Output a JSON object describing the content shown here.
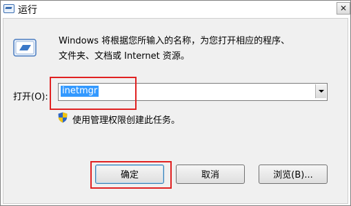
{
  "window": {
    "title": "运行",
    "close_glyph": "✕"
  },
  "description": {
    "line1": "Windows 将根据您所输入的名称，为您打开相应的程序、",
    "line2": "文件夹、文档或 Internet 资源。"
  },
  "open_field": {
    "label": "打开(O):",
    "value": "inetmgr"
  },
  "admin_note": "使用管理权限创建此任务。",
  "buttons": {
    "ok": "确定",
    "cancel": "取消",
    "browse": "浏览(B)..."
  },
  "colors": {
    "selection": "#3399ff",
    "highlight_box": "#e02020",
    "dialog_bg": "#f0f0f0"
  },
  "icons": {
    "title": "run-app-icon",
    "run": "run-app-icon",
    "uac": "uac-shield-icon",
    "dropdown": "chevron-down-icon"
  }
}
